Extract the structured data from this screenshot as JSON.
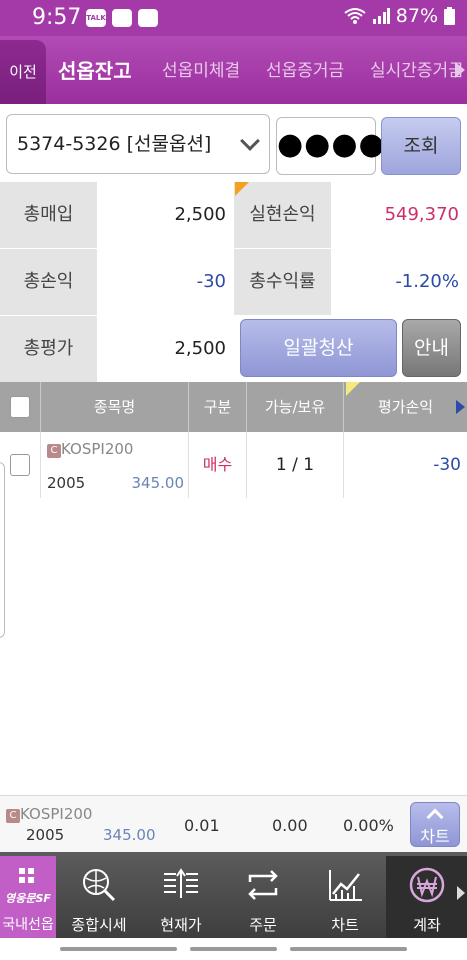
{
  "status_bar": {
    "time": "9:57",
    "battery": "87%"
  },
  "tabs": {
    "back_label": "이전",
    "items": [
      {
        "label": "선옵잔고",
        "active": true
      },
      {
        "label": "선옵미체결",
        "active": false
      },
      {
        "label": "선옵증거금",
        "active": false
      },
      {
        "label": "실시간증거금",
        "active": false
      }
    ]
  },
  "account": {
    "selected": "5374-5326 [선물옵션]",
    "password_mask": "●●●●",
    "query_label": "조회"
  },
  "summary": {
    "total_purchase_label": "총매입",
    "total_purchase_value": "2,500",
    "realized_pl_label": "실현손익",
    "realized_pl_value": "549,370",
    "total_pl_label": "총손익",
    "total_pl_value": "-30",
    "total_return_label": "총수익률",
    "total_return_value": "-1.20%",
    "total_eval_label": "총평가",
    "total_eval_value": "2,500",
    "liquidate_all_label": "일괄청산",
    "info_label": "안내"
  },
  "table": {
    "headers": [
      "종목명",
      "구분",
      "가능/보유",
      "평가손익"
    ],
    "rows": [
      {
        "badge": "C",
        "symbol": "KOSPI200",
        "code": "2005",
        "price": "345.00",
        "side": "매수",
        "available_held": "1 / 1",
        "eval_pl": "-30"
      }
    ]
  },
  "quote_bar": {
    "badge": "C",
    "symbol": "KOSPI200",
    "code": "2005",
    "price": "345.00",
    "v1": "0.01",
    "v2": "0.00",
    "v3": "0.00%",
    "chart_label": "차트"
  },
  "nav": {
    "logo_text": "영웅문SF",
    "items": [
      {
        "label": "국내선옵",
        "icon": "grid-icon"
      },
      {
        "label": "종합시세",
        "icon": "globe-search-icon"
      },
      {
        "label": "현재가",
        "icon": "price-bars-icon"
      },
      {
        "label": "주문",
        "icon": "exchange-arrows-icon"
      },
      {
        "label": "차트",
        "icon": "line-chart-icon"
      },
      {
        "label": "계좌",
        "icon": "won-icon"
      }
    ]
  },
  "colors": {
    "brand_purple": "#a43aa8",
    "profit_red": "#cc2f6b",
    "loss_blue": "#2d4ba6",
    "button_lavender": "#9ea5dc"
  }
}
